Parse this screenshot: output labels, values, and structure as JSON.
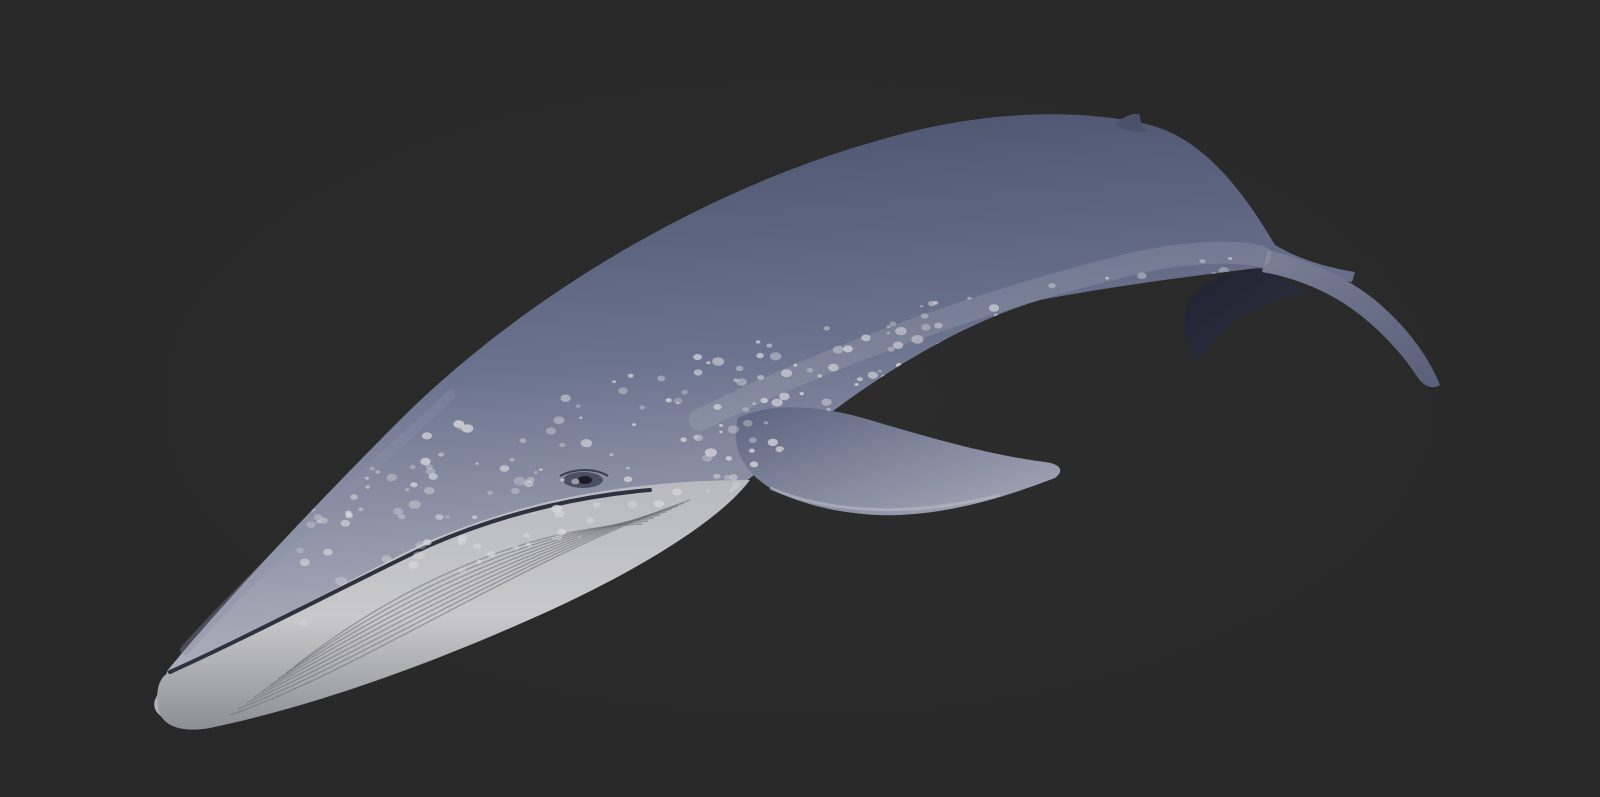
{
  "scene": {
    "subject": "whale-render",
    "background_color": "#272727",
    "background_center_color": "#2c2c2c",
    "colors": {
      "back_dark": "#49506a",
      "back_mid": "#6b728e",
      "flank_light": "#9fa3b2",
      "belly_light": "#c9c9cb",
      "jaw_shadow": "#3a3e4c",
      "spots": "#d8d8dc",
      "grooves": "#6f7079"
    }
  }
}
